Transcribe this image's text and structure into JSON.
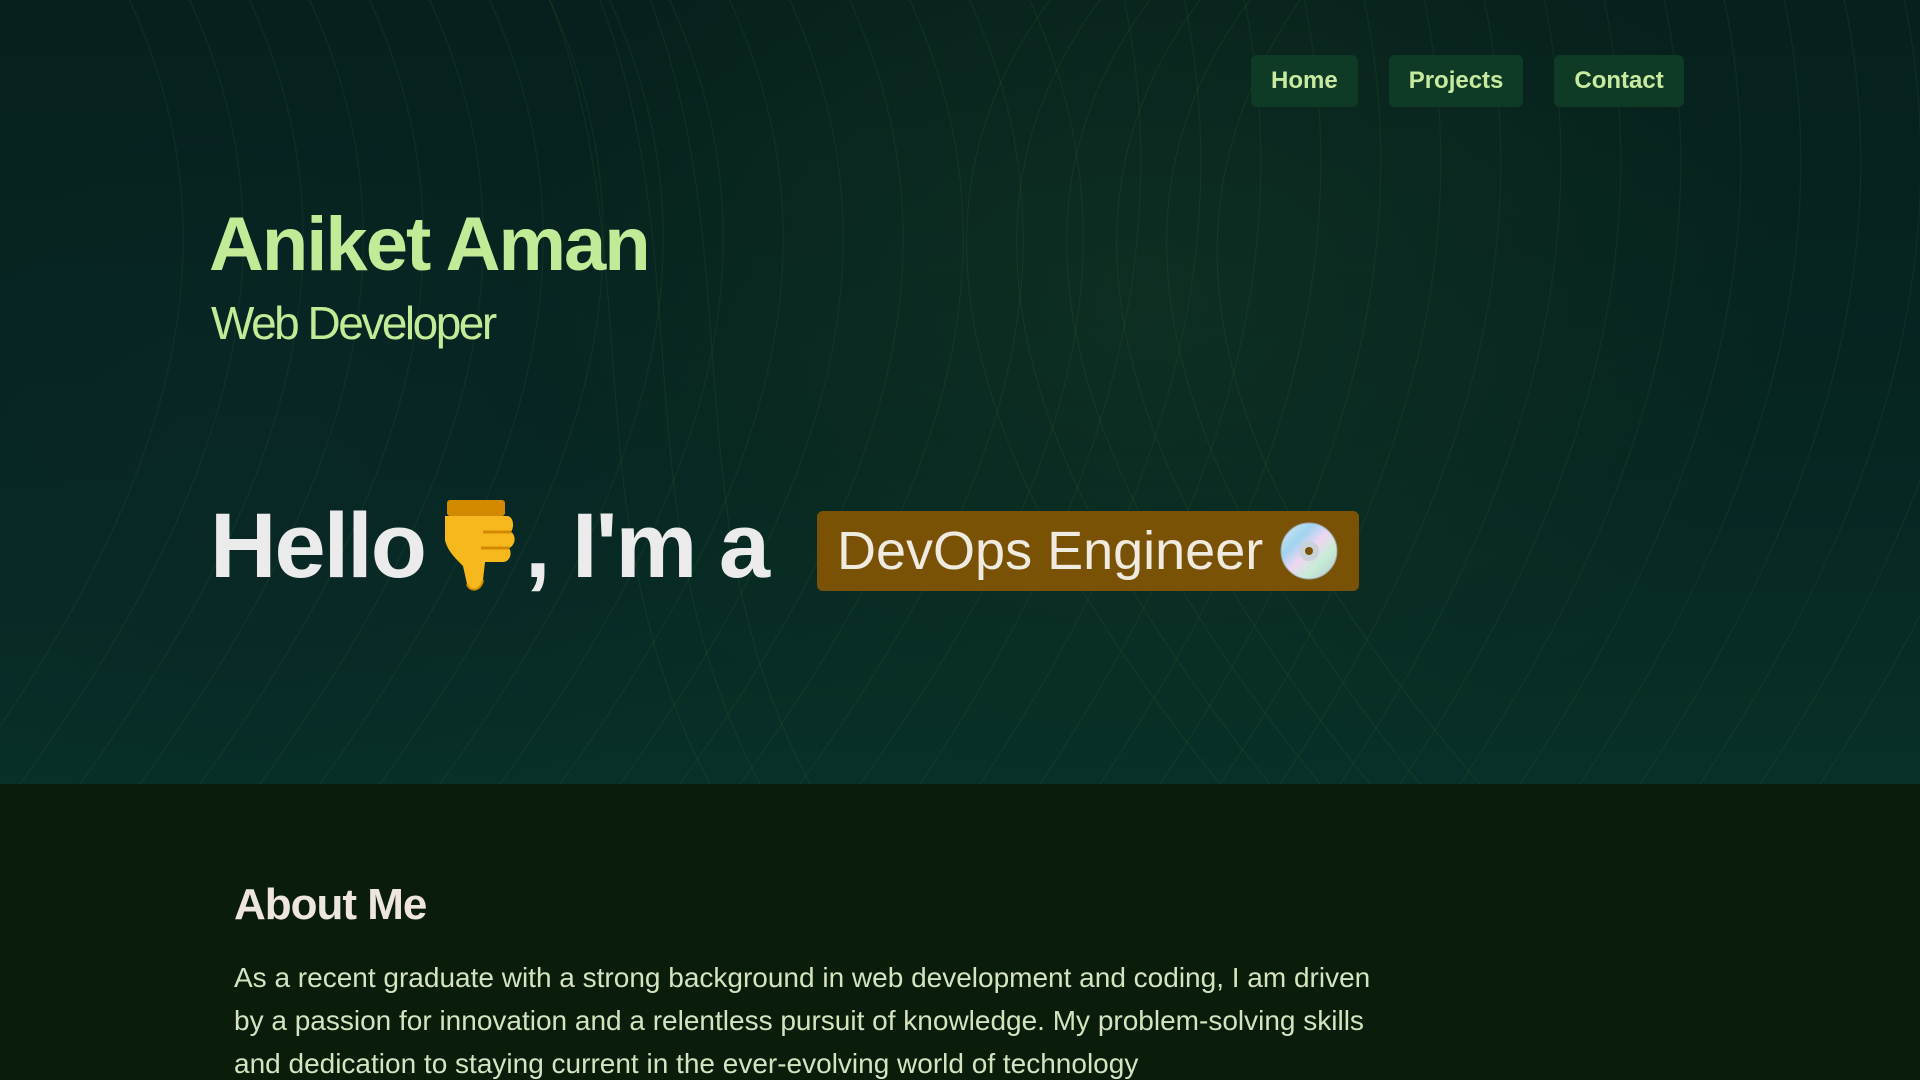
{
  "nav": {
    "items": [
      {
        "label": "Home"
      },
      {
        "label": "Projects"
      },
      {
        "label": "Contact"
      }
    ]
  },
  "hero": {
    "name": "Aniket Aman",
    "role": "Web Developer",
    "greeting_hello": "Hello",
    "greeting_rest": ", I'm a",
    "greeting_emoji": "thumbs-down-icon",
    "badge_text": "DevOps Engineer",
    "badge_icon": "optical-disc-icon",
    "badge_color": "#7a5206"
  },
  "about": {
    "title": "About Me",
    "text": "As a recent graduate with a strong background in web development and coding, I am driven by a passion for innovation and a relentless pursuit of knowledge. My problem-solving skills and dedication to staying current in the ever-evolving world of technology"
  },
  "colors": {
    "accent": "#c3ea96",
    "nav_bg": "#0f3a26",
    "about_bg": "#0a1c0a"
  }
}
